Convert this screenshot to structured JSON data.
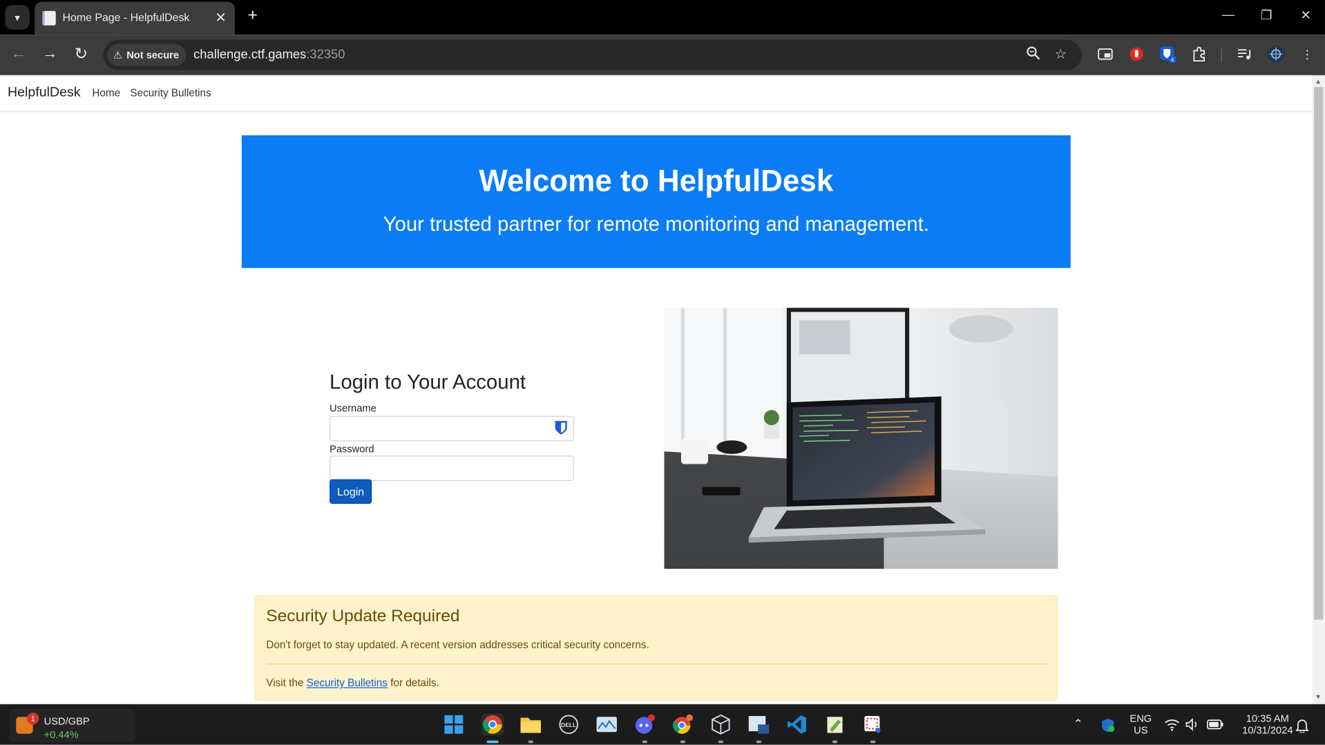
{
  "browser": {
    "tab_title": "Home Page - HelpfulDesk",
    "tab_close": "✕",
    "new_tab": "+",
    "security_chip": "Not secure",
    "url_host": "challenge.ctf.games",
    "url_port": ":32350",
    "window_controls": {
      "minimize": "—",
      "restore": "❐",
      "close": "✕"
    }
  },
  "site": {
    "brand": "HelpfulDesk",
    "nav": [
      "Home",
      "Security Bulletins"
    ]
  },
  "hero": {
    "title": "Welcome to HelpfulDesk",
    "subtitle": "Your trusted partner for remote monitoring and management."
  },
  "login": {
    "heading": "Login to Your Account",
    "username_label": "Username",
    "username_value": "",
    "password_label": "Password",
    "password_value": "",
    "button": "Login"
  },
  "alert": {
    "title": "Security Update Required",
    "message": "Don't forget to stay updated. A recent version addresses critical security concerns.",
    "visit_prefix": "Visit the ",
    "link": "Security Bulletins",
    "visit_suffix": " for details."
  },
  "taskbar": {
    "widget_badge": "1",
    "widget_title": "USD/GBP",
    "widget_value": "+0.44%",
    "lang_top": "ENG",
    "lang_bottom": "US",
    "time": "10:35 AM",
    "date": "10/31/2024"
  },
  "colors": {
    "hero_bg": "#0b7cf6",
    "login_button": "#0d5bbf",
    "alert_bg": "#fff3cd",
    "alert_text": "#664d03",
    "link": "#0b5ed7"
  }
}
